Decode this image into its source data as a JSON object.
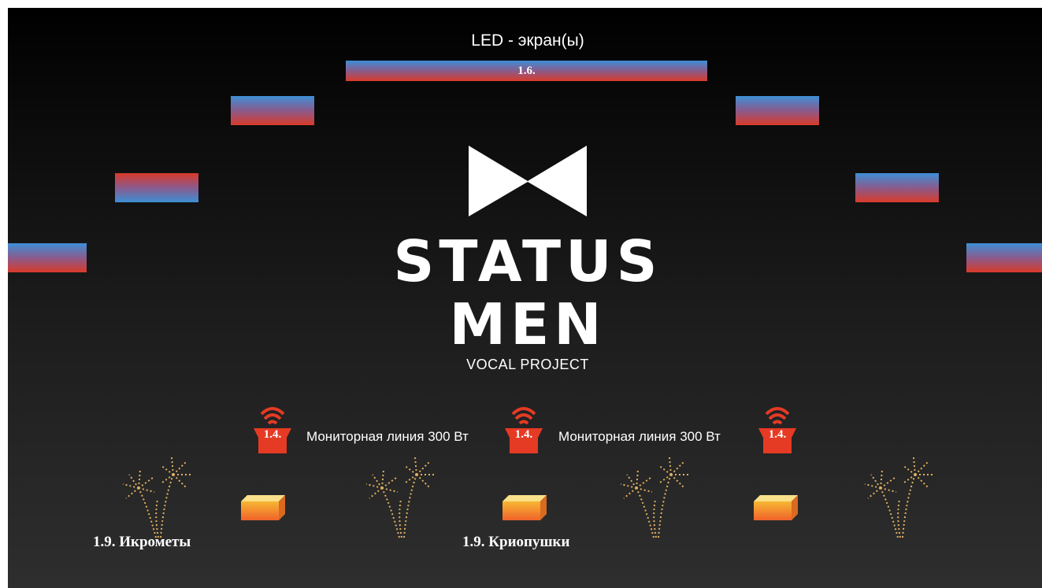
{
  "title": "LED - экран(ы)",
  "led_center_label": "1.6.",
  "logo": {
    "line1": "STATUS",
    "line2": "MEN",
    "tagline": "VOCAL PROJECT"
  },
  "monitors": {
    "number": "1.4.",
    "line_label": "Мониторная линия 300 Вт"
  },
  "bottom_labels": {
    "sparklers": "1.9. Икрометы",
    "cryo": "1.9. Криопушки"
  },
  "colors": {
    "led_blue": "#3d8fd6",
    "led_red": "#d93a2a",
    "monitor_red": "#e53a24",
    "firework_gold": "#e0b060",
    "box_orange": "#f29a2e"
  }
}
